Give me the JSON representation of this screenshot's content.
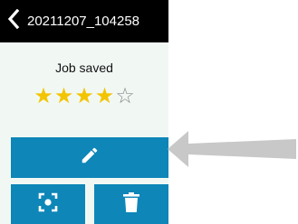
{
  "header": {
    "title": "20211207_104258",
    "back_icon": "chevron-left-icon"
  },
  "status": {
    "text": "Job saved"
  },
  "rating": {
    "value": 4,
    "max": 5,
    "filled_color": "#f3c400",
    "empty_color": "#8a8a8a"
  },
  "actions": {
    "edit_icon": "pencil-icon",
    "focus_icon": "focus-icon",
    "delete_icon": "trash-icon",
    "button_color": "#0e86b8"
  },
  "annotation": {
    "arrow_icon": "arrow-left-icon",
    "arrow_color": "#c8c8c8"
  }
}
